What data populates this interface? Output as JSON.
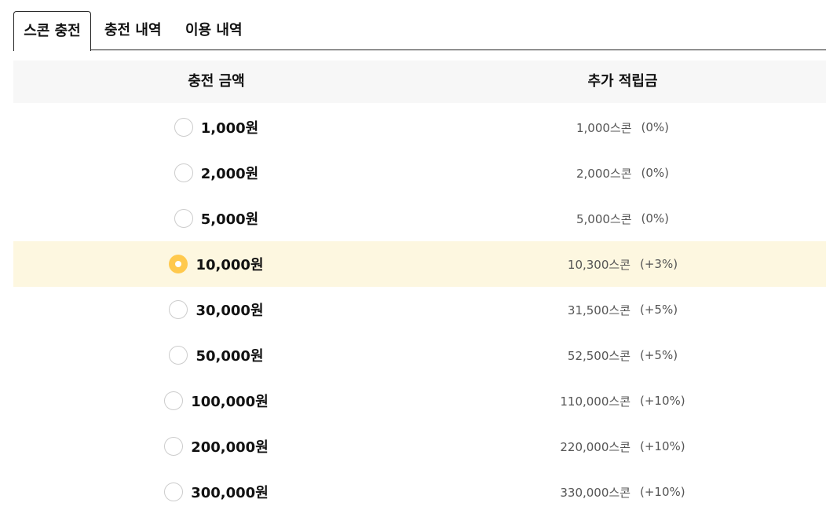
{
  "tabs": [
    {
      "label": "스콘 충전",
      "active": true
    },
    {
      "label": "충전 내역",
      "active": false
    },
    {
      "label": "이용 내역",
      "active": false
    }
  ],
  "table": {
    "headers": {
      "amount": "충전 금액",
      "bonus": "추가 적립금"
    },
    "rows": [
      {
        "amount": "1,000원",
        "bonus": "1,000스콘",
        "rate": "(0%)",
        "selected": false
      },
      {
        "amount": "2,000원",
        "bonus": "2,000스콘",
        "rate": "(0%)",
        "selected": false
      },
      {
        "amount": "5,000원",
        "bonus": "5,000스콘",
        "rate": "(0%)",
        "selected": false
      },
      {
        "amount": "10,000원",
        "bonus": "10,300스콘",
        "rate": "(+3%)",
        "selected": true
      },
      {
        "amount": "30,000원",
        "bonus": "31,500스콘",
        "rate": "(+5%)",
        "selected": false
      },
      {
        "amount": "50,000원",
        "bonus": "52,500스콘",
        "rate": "(+5%)",
        "selected": false
      },
      {
        "amount": "100,000원",
        "bonus": "110,000스콘",
        "rate": "(+10%)",
        "selected": false
      },
      {
        "amount": "200,000원",
        "bonus": "220,000스콘",
        "rate": "(+10%)",
        "selected": false
      },
      {
        "amount": "300,000원",
        "bonus": "330,000스콘",
        "rate": "(+10%)",
        "selected": false
      }
    ]
  },
  "colors": {
    "accent": "#ffc94d",
    "selected_row_bg": "#fdf7e0",
    "header_bg": "#f7f7f7"
  }
}
